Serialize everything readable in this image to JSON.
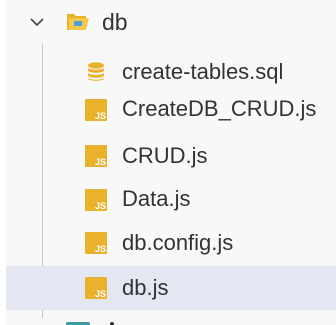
{
  "explorer": {
    "folder": {
      "name": "db",
      "expanded": true,
      "icon": "folder-open-icon",
      "icon_color": "#e8b22e"
    },
    "files": [
      {
        "name": "create-tables.sql",
        "icon": "database-icon",
        "icon_color": "#e8b22e",
        "selected": false
      },
      {
        "name": "CreateDB_CRUD.js",
        "icon": "javascript-file-icon",
        "icon_color": "#e8b22e",
        "selected": false
      },
      {
        "name": "CRUD.js",
        "icon": "javascript-file-icon",
        "icon_color": "#e8b22e",
        "selected": false
      },
      {
        "name": "Data.js",
        "icon": "javascript-file-icon",
        "icon_color": "#e8b22e",
        "selected": false
      },
      {
        "name": "db.config.js",
        "icon": "javascript-file-icon",
        "icon_color": "#e8b22e",
        "selected": false
      },
      {
        "name": "db.js",
        "icon": "javascript-file-icon",
        "icon_color": "#e8b22e",
        "selected": true
      }
    ],
    "js_badge": "JS",
    "selection_color": "#e4e6f1"
  }
}
